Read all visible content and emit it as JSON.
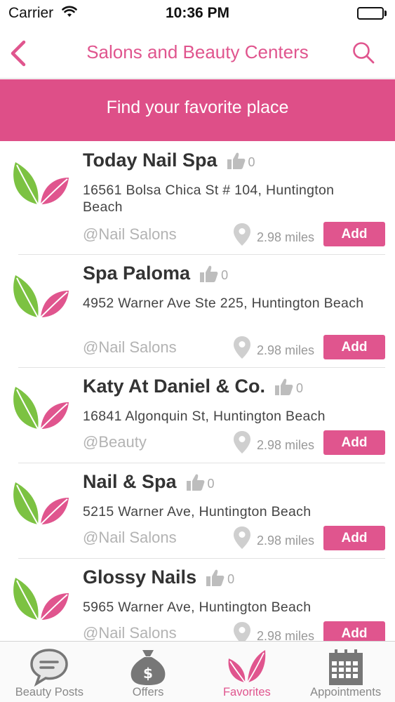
{
  "status_bar": {
    "carrier": "Carrier",
    "time": "10:36 PM"
  },
  "nav": {
    "title": "Salons and Beauty Centers",
    "back_icon": "chevron-left-icon",
    "search_icon": "search-icon"
  },
  "banner": {
    "text": "Find your favorite place"
  },
  "colors": {
    "accent": "#e0558e",
    "banner": "#de4f88",
    "leaf_green": "#7cc242",
    "leaf_pink": "#e0558e"
  },
  "places": [
    {
      "name": "Today Nail Spa",
      "likes": "0",
      "address": "16561 Bolsa Chica St # 104, Huntington Beach",
      "category": "@Nail Salons",
      "distance": "2.98 miles",
      "add_label": "Add"
    },
    {
      "name": "Spa Paloma",
      "likes": "0",
      "address": "4952 Warner Ave Ste 225, Huntington Beach",
      "category": "@Nail Salons",
      "distance": "2.98 miles",
      "add_label": "Add"
    },
    {
      "name": "Katy At Daniel & Co.",
      "likes": "0",
      "address": "16841 Algonquin St, Huntington Beach",
      "category": "@Beauty",
      "distance": "2.98 miles",
      "add_label": "Add"
    },
    {
      "name": "Nail & Spa",
      "likes": "0",
      "address": "5215 Warner Ave, Huntington Beach",
      "category": "@Nail Salons",
      "distance": "2.98 miles",
      "add_label": "Add"
    },
    {
      "name": "Glossy Nails",
      "likes": "0",
      "address": "5965 Warner Ave, Huntington Beach",
      "category": "@Nail Salons",
      "distance": "2.98 miles",
      "add_label": "Add"
    }
  ],
  "tabs": [
    {
      "label": "Beauty Posts",
      "icon": "chat-bubble-icon",
      "active": false
    },
    {
      "label": "Offers",
      "icon": "money-bag-icon",
      "active": false
    },
    {
      "label": "Favorites",
      "icon": "leaf-icon",
      "active": true
    },
    {
      "label": "Appointments",
      "icon": "calendar-icon",
      "active": false
    }
  ]
}
